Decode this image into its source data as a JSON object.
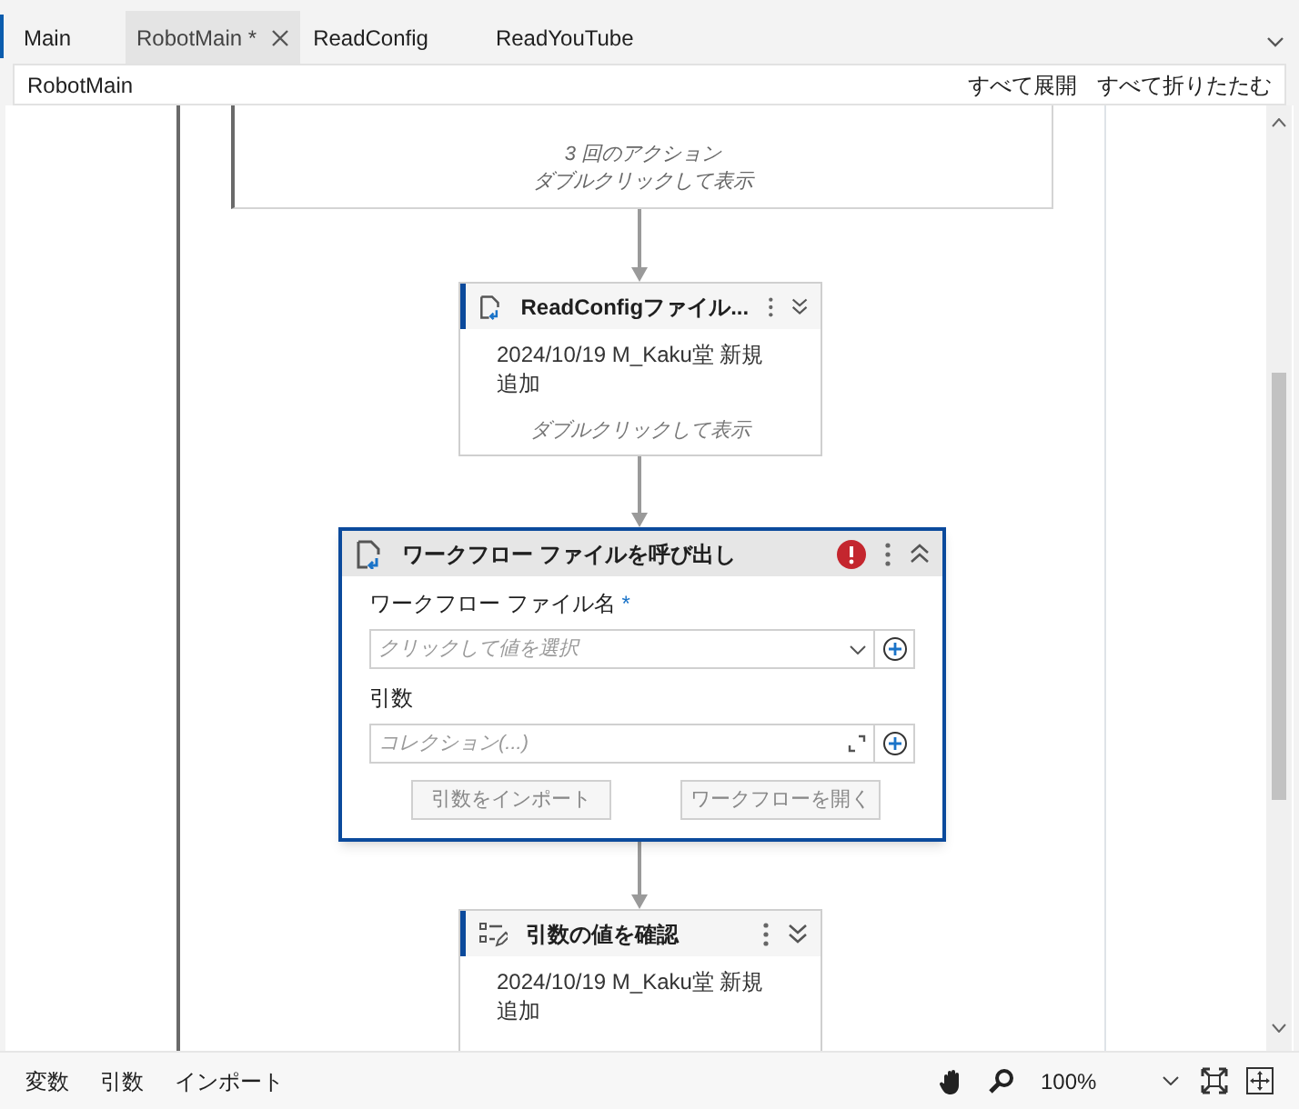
{
  "tabs": [
    {
      "label": "Main",
      "selected": false
    },
    {
      "label": "RobotMain *",
      "selected": true
    },
    {
      "label": "ReadConfig",
      "selected": false
    },
    {
      "label": "ReadYouTube",
      "selected": false
    }
  ],
  "breadcrumb": "RobotMain",
  "header_actions": [
    "すべて展開",
    "すべて折りたたむ"
  ],
  "canvas": {
    "sequence": {
      "summary": "3 回のアクション",
      "hint": "ダブルクリックして表示"
    },
    "activities": [
      {
        "kind": "invoke_workflow",
        "expanded": false,
        "selected": false,
        "title": "ReadConfigファイル...",
        "annotation": "2024/10/19 M_Kaku堂 新規追加",
        "hint": "ダブルクリックして表示"
      },
      {
        "kind": "invoke_workflow",
        "expanded": true,
        "selected": true,
        "error": true,
        "title": "ワークフロー ファイルを呼び出し",
        "fields": [
          {
            "kind": "dropdown",
            "label": "ワークフロー ファイル名",
            "required_mark": "*",
            "placeholder": "クリックして値を選択"
          },
          {
            "kind": "collection",
            "label": "引数",
            "placeholder": "コレクション(...)"
          }
        ],
        "buttons": [
          {
            "label": "引数をインポート",
            "disabled": true
          },
          {
            "label": "ワークフローを開く",
            "disabled": true
          }
        ]
      },
      {
        "kind": "check_arguments",
        "expanded": false,
        "selected": false,
        "title": "引数の値を確認",
        "annotation": "2024/10/19 M_Kaku堂 新規追加"
      }
    ]
  },
  "bottom_bar": {
    "tabs": [
      "変数",
      "引数",
      "インポート"
    ],
    "zoom": "100%"
  }
}
